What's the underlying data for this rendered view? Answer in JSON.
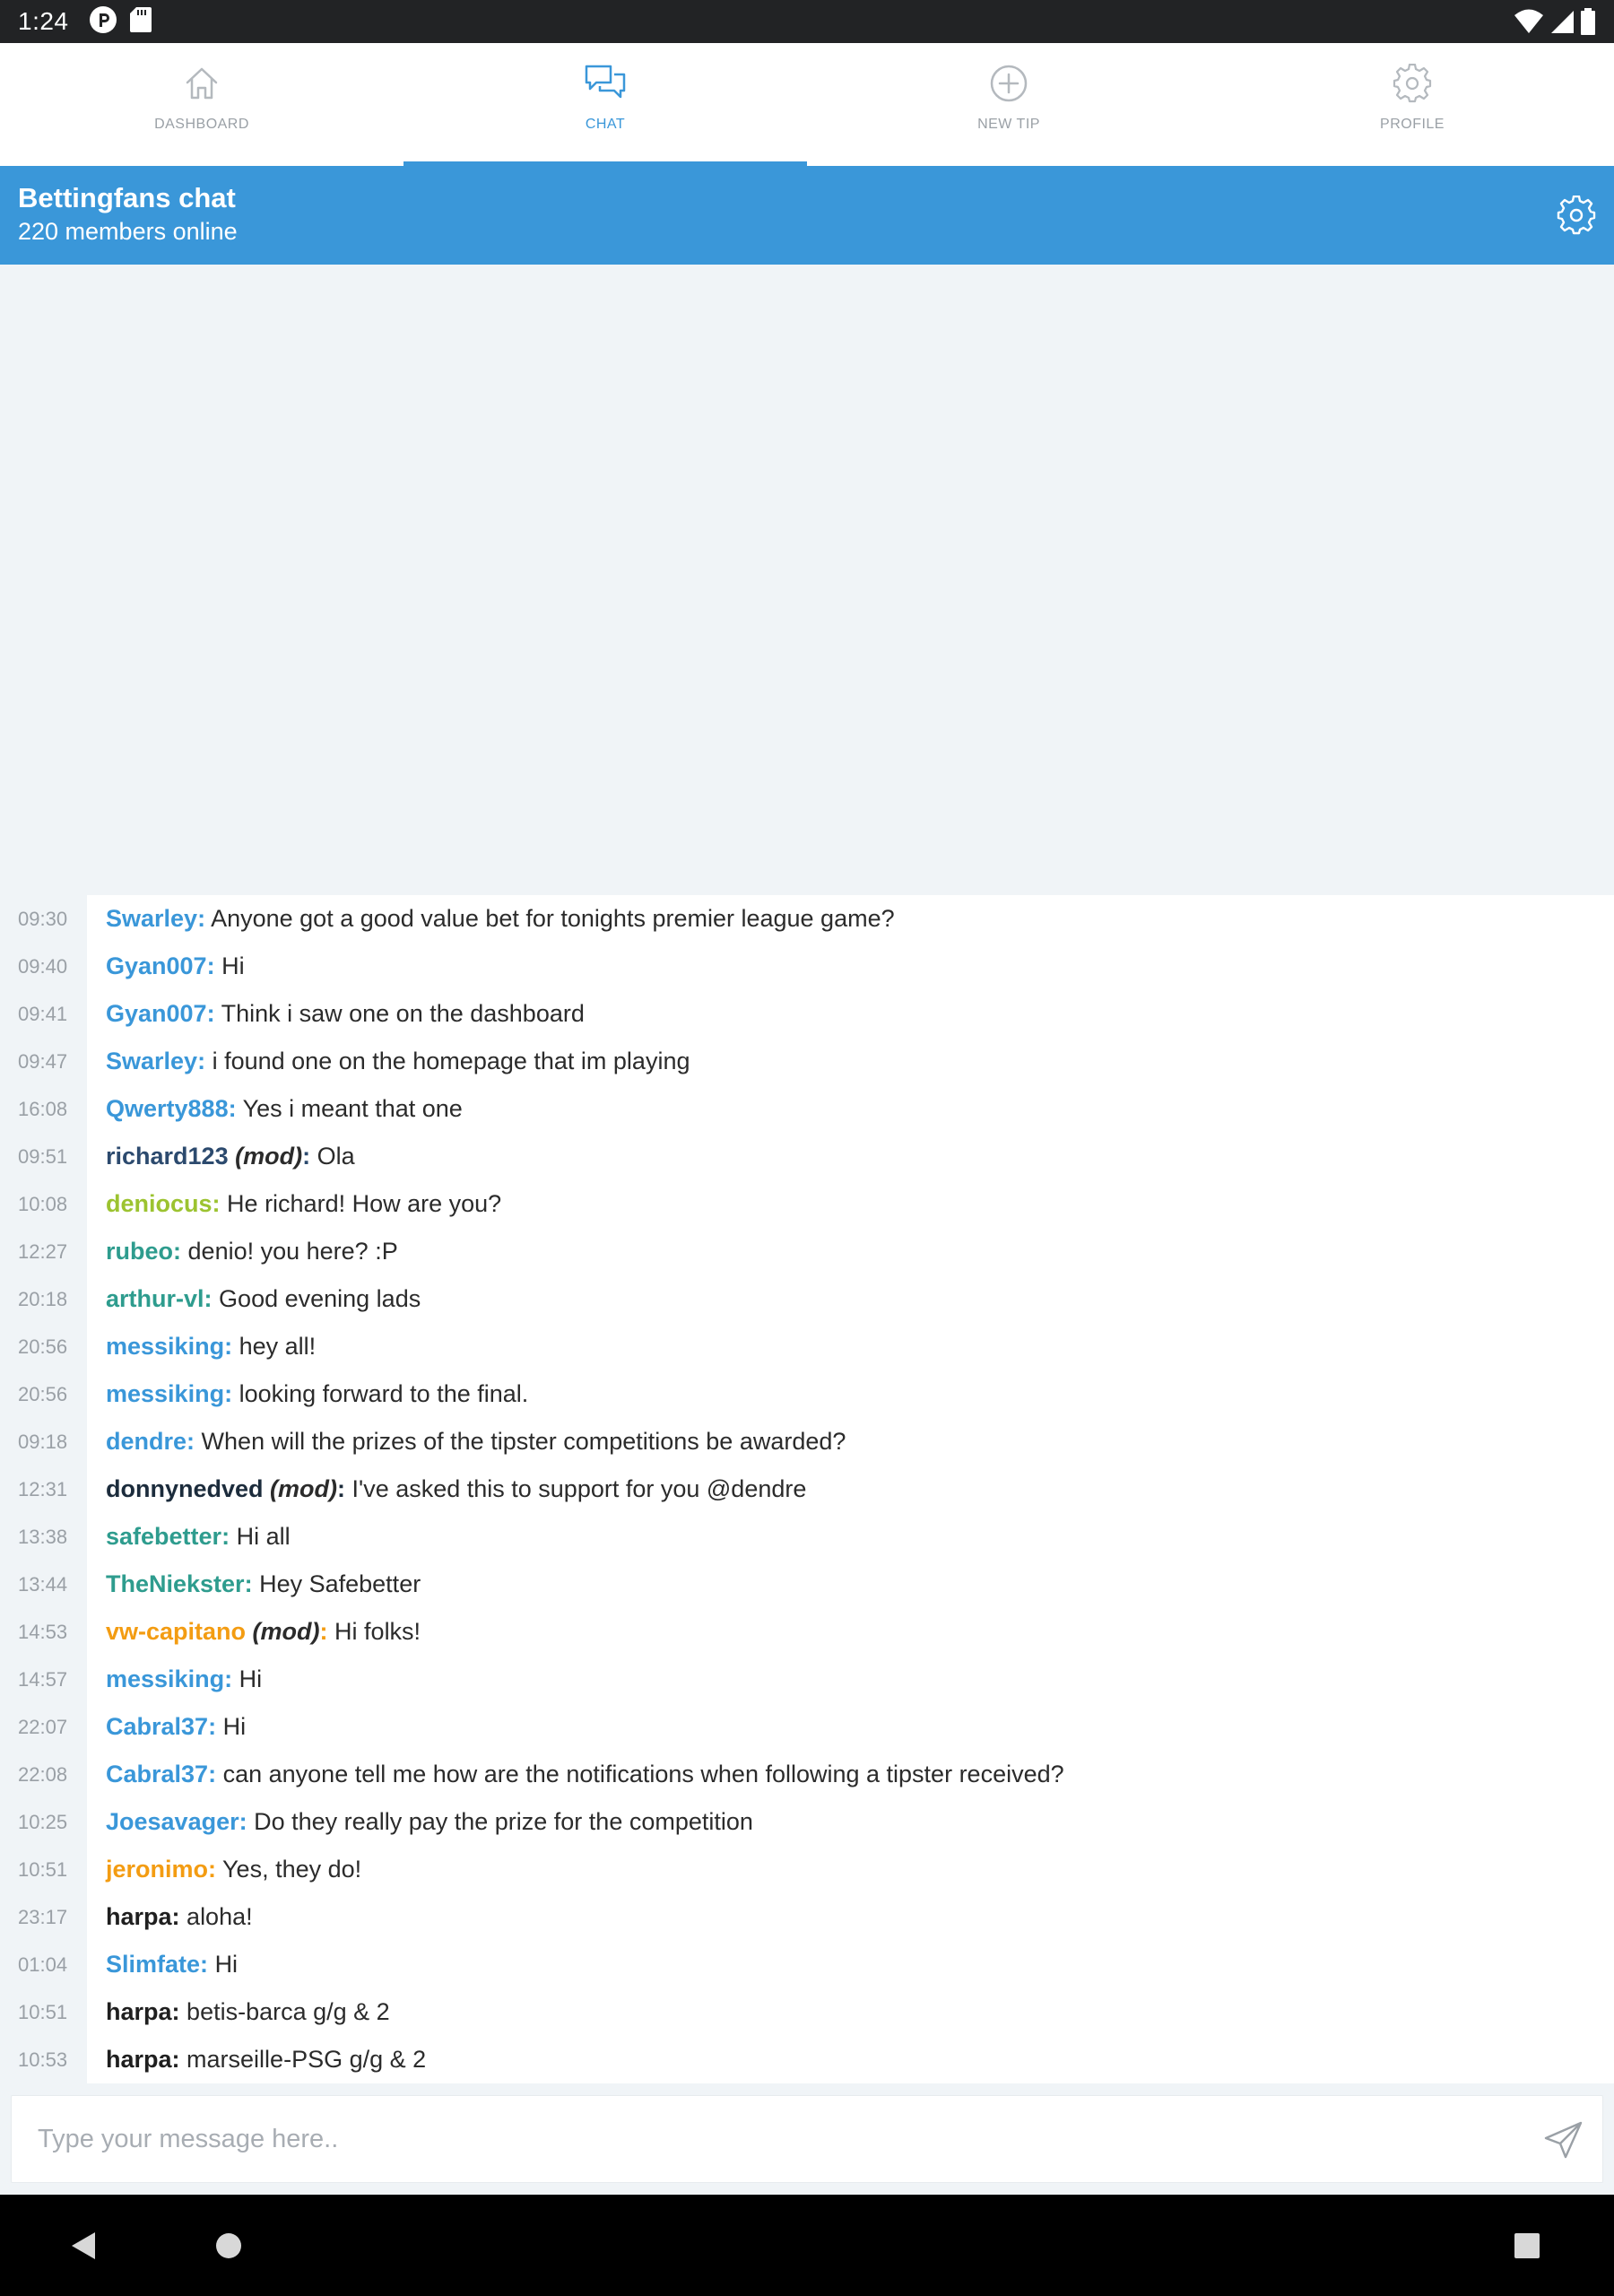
{
  "status_bar": {
    "time": "1:24",
    "left_icons": [
      "p-circle-icon",
      "sd-card-icon"
    ],
    "right_icons": [
      "wifi-icon",
      "cell-signal-icon",
      "battery-icon"
    ]
  },
  "tabs": [
    {
      "label": "DASHBOARD",
      "icon": "home-icon",
      "active": false
    },
    {
      "label": "CHAT",
      "icon": "chat-bubbles-icon",
      "active": true
    },
    {
      "label": "NEW TIP",
      "icon": "plus-circle-icon",
      "active": false
    },
    {
      "label": "PROFILE",
      "icon": "gear-icon",
      "active": false
    }
  ],
  "header": {
    "title": "Bettingfans chat",
    "subtitle": "220 members online"
  },
  "messages": [
    {
      "time": "09:30",
      "user": "Swarley",
      "mod": "",
      "text": "Anyone got a good value bet for tonights premier league  game?",
      "color": "#3a97d9"
    },
    {
      "time": "09:40",
      "user": "Gyan007",
      "mod": "",
      "text": "Hi",
      "color": "#3a97d9"
    },
    {
      "time": "09:41",
      "user": "Gyan007",
      "mod": "",
      "text": "Think i saw one on the dashboard",
      "color": "#3a97d9"
    },
    {
      "time": "09:47",
      "user": "Swarley",
      "mod": "",
      "text": "i found one on the homepage that im playing",
      "color": "#3a97d9"
    },
    {
      "time": "16:08",
      "user": "Qwerty888",
      "mod": "",
      "text": "Yes i meant that one",
      "color": "#3a97d9"
    },
    {
      "time": "09:51",
      "user": "richard123",
      "mod": "(mod)",
      "text": "Ola",
      "color": "#2c4a6e"
    },
    {
      "time": "10:08",
      "user": "deniocus",
      "mod": "",
      "text": "He richard! How are you?",
      "color": "#9cc330"
    },
    {
      "time": "12:27",
      "user": "rubeo",
      "mod": "",
      "text": "denio! you here? :P",
      "color": "#2e9c8e"
    },
    {
      "time": "20:18",
      "user": "arthur-vl",
      "mod": "",
      "text": "Good evening lads",
      "color": "#2e9c8e"
    },
    {
      "time": "20:56",
      "user": "messiking",
      "mod": "",
      "text": "hey all!",
      "color": "#3a97d9"
    },
    {
      "time": "20:56",
      "user": "messiking",
      "mod": "",
      "text": "looking forward to the final.",
      "color": "#3a97d9"
    },
    {
      "time": "09:18",
      "user": "dendre",
      "mod": "",
      "text": "When will the prizes of the tipster competitions be awarded?",
      "color": "#3a97d9"
    },
    {
      "time": "12:31",
      "user": "donnynedved",
      "mod": "(mod)",
      "text": "I've asked this to support for you @dendre",
      "color": "#1c2c3c"
    },
    {
      "time": "13:38",
      "user": "safebetter",
      "mod": "",
      "text": "Hi all",
      "color": "#2e9c8e"
    },
    {
      "time": "13:44",
      "user": "TheNiekster",
      "mod": "",
      "text": "Hey Safebetter",
      "color": "#2e9c8e"
    },
    {
      "time": "14:53",
      "user": "vw-capitano",
      "mod": "(mod)",
      "text": "Hi folks!",
      "color": "#f39c12"
    },
    {
      "time": "14:57",
      "user": "messiking",
      "mod": "",
      "text": "Hi",
      "color": "#3a97d9"
    },
    {
      "time": "22:07",
      "user": "Cabral37",
      "mod": "",
      "text": "Hi",
      "color": "#3a97d9"
    },
    {
      "time": "22:08",
      "user": "Cabral37",
      "mod": "",
      "text": "can anyone tell me how are the notifications when following a tipster received?",
      "color": "#3a97d9"
    },
    {
      "time": "10:25",
      "user": "Joesavager",
      "mod": "",
      "text": "Do they  really pay the prize for the competition",
      "color": "#3a97d9"
    },
    {
      "time": "10:51",
      "user": "jeronimo",
      "mod": "",
      "text": "Yes, they do!",
      "color": "#f39c12"
    },
    {
      "time": "23:17",
      "user": "harpa",
      "mod": "",
      "text": "aloha!",
      "color": "#1f1f1f"
    },
    {
      "time": "01:04",
      "user": "Slimfate",
      "mod": "",
      "text": "Hi",
      "color": "#3a97d9"
    },
    {
      "time": "10:51",
      "user": "harpa",
      "mod": "",
      "text": "betis-barca g/g & 2",
      "color": "#1f1f1f"
    },
    {
      "time": "10:53",
      "user": "harpa",
      "mod": "",
      "text": "marseille-PSG g/g & 2",
      "color": "#1f1f1f"
    }
  ],
  "composer": {
    "placeholder": "Type your message here..",
    "value": ""
  },
  "nav_bar": {
    "icons": [
      "back-icon",
      "home-circle-icon",
      "recents-icon"
    ]
  },
  "colors": {
    "accent": "#3a97d9",
    "panel_background": "#f0f4f7",
    "inactive_tab": "#9aa0a6"
  }
}
